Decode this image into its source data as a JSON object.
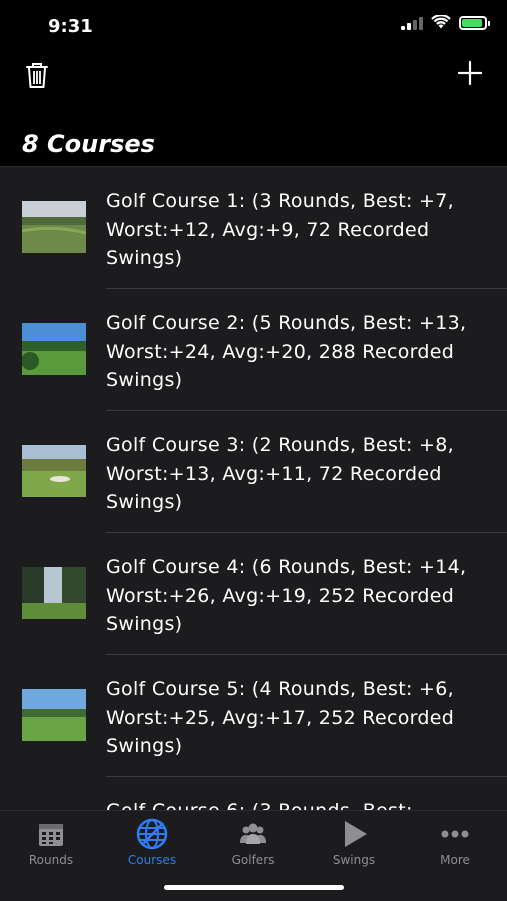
{
  "status_bar": {
    "time": "9:31"
  },
  "header": {
    "title": "8 Courses"
  },
  "courses": [
    {
      "label": "Golf Course 1: (3 Rounds, Best: +7, Worst:+12, Avg:+9, 72 Recorded Swings)"
    },
    {
      "label": "Golf Course 2: (5 Rounds, Best: +13, Worst:+24, Avg:+20, 288 Recorded Swings)"
    },
    {
      "label": "Golf Course 3: (2 Rounds, Best: +8, Worst:+13, Avg:+11, 72 Recorded Swings)"
    },
    {
      "label": "Golf Course 4: (6 Rounds, Best: +14, Worst:+26, Avg:+19, 252 Recorded Swings)"
    },
    {
      "label": "Golf Course 5: (4 Rounds, Best: +6, Worst:+25, Avg:+17, 252 Recorded Swings)"
    },
    {
      "label": "Golf Course 6: (3 Rounds, Best:"
    }
  ],
  "tabs": [
    {
      "label": "Rounds",
      "icon": "calendar-icon"
    },
    {
      "label": "Courses",
      "icon": "globe-icon",
      "active": true
    },
    {
      "label": "Golfers",
      "icon": "people-icon"
    },
    {
      "label": "Swings",
      "icon": "play-icon"
    },
    {
      "label": "More",
      "icon": "more-icon"
    }
  ],
  "colors": {
    "accent": "#2f7cf6",
    "list_bg": "#1c1c1e",
    "inactive": "#8e8e93"
  }
}
